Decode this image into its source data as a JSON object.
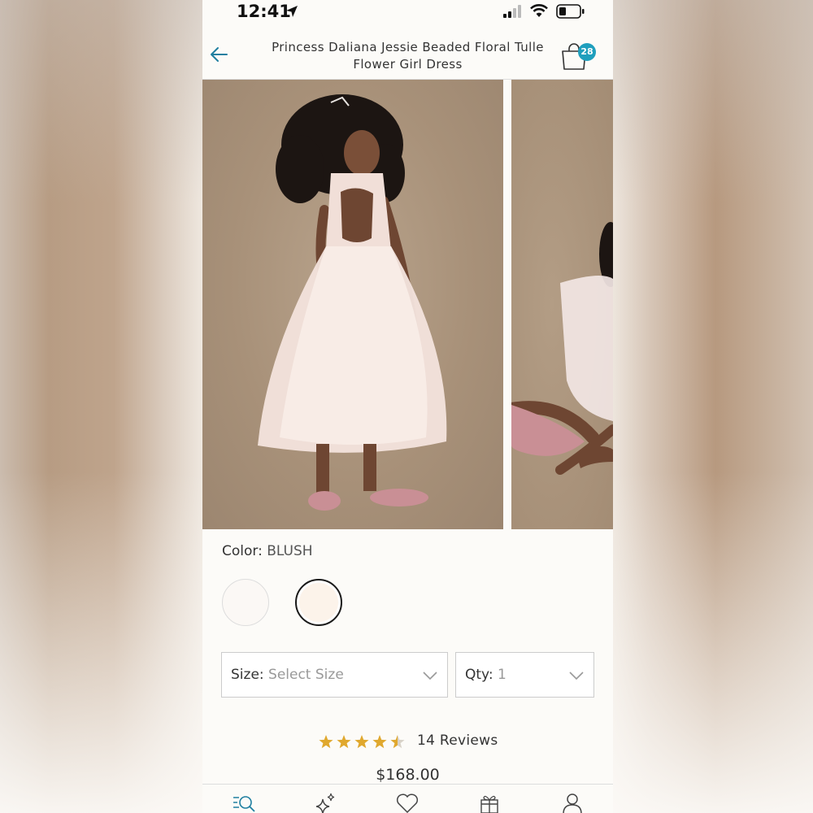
{
  "status_bar": {
    "time": "12:41"
  },
  "header": {
    "title": "Princess Daliana Jessie Beaded Floral Tulle Flower Girl Dress",
    "cart_count": "28"
  },
  "product": {
    "color_label": "Color:",
    "color_value": "BLUSH",
    "size_label": "Size:",
    "size_value": "Select Size",
    "qty_label": "Qty:",
    "qty_value": "1",
    "rating": 4.5,
    "rating_max": 5,
    "reviews": "14 Reviews",
    "price": "$168.00"
  },
  "colors": {
    "accent": "#1f9fbd",
    "star": "#e0a82e",
    "swatch_white": "#fbf8f5",
    "swatch_blush": "#fcf3ea"
  },
  "bottom_nav": [
    "search-icon",
    "sparkle-icon",
    "heart-icon",
    "gift-icon",
    "account-icon"
  ]
}
